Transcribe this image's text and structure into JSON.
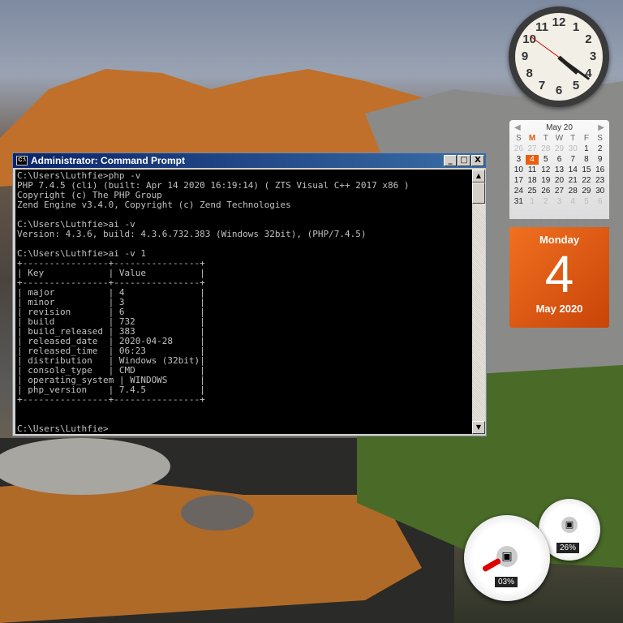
{
  "window": {
    "title": "Administrator: Command Prompt",
    "icon": "cmd-icon",
    "minimize": "_",
    "maximize": "□",
    "close": "X"
  },
  "console_lines": [
    "C:\\Users\\Luthfie>php -v",
    "PHP 7.4.5 (cli) (built: Apr 14 2020 16:19:14) ( ZTS Visual C++ 2017 x86 )",
    "Copyright (c) The PHP Group",
    "Zend Engine v3.4.0, Copyright (c) Zend Technologies",
    "",
    "C:\\Users\\Luthfie>ai -v",
    "Version: 4.3.6, build: 4.3.6.732.383 (Windows 32bit), (PHP/7.4.5)",
    "",
    "C:\\Users\\Luthfie>ai -v 1",
    "+----------------+----------------+",
    "| Key            | Value          |",
    "+----------------+----------------+",
    "| major          | 4              |",
    "| minor          | 3              |",
    "| revision       | 6              |",
    "| build          | 732            |",
    "| build_released | 383            |",
    "| released_date  | 2020-04-28     |",
    "| released_time  | 06:23          |",
    "| distribution   | Windows (32bit)|",
    "| console_type   | CMD            |",
    "| operating_system | WINDOWS      |",
    "| php_version    | 7.4.5          |",
    "+----------------+----------------+",
    "",
    "",
    "C:\\Users\\Luthfie>"
  ],
  "clock": {
    "numbers": [
      "12",
      "1",
      "2",
      "3",
      "4",
      "5",
      "6",
      "7",
      "8",
      "9",
      "10",
      "11"
    ],
    "hour": 4,
    "minute": 21,
    "second": 51
  },
  "calendar": {
    "month_label": "May 20",
    "prev": "◀",
    "next": "▶",
    "weekdays": [
      "S",
      "M",
      "T",
      "W",
      "T",
      "F",
      "S"
    ],
    "days": [
      "26",
      "27",
      "28",
      "29",
      "30",
      "1",
      "2",
      "3",
      "4",
      "5",
      "6",
      "7",
      "8",
      "9",
      "10",
      "11",
      "12",
      "13",
      "14",
      "15",
      "16",
      "17",
      "18",
      "19",
      "20",
      "21",
      "22",
      "23",
      "24",
      "25",
      "26",
      "27",
      "28",
      "29",
      "30",
      "31",
      "1",
      "2",
      "3",
      "4",
      "5",
      "6"
    ],
    "selected_index": 8,
    "weekday": "Monday",
    "day": "4",
    "month_year": "May 2020"
  },
  "gauges": {
    "cpu": {
      "value": "03%",
      "percent": 3
    },
    "memory": {
      "value": "26%",
      "percent": 26
    }
  }
}
